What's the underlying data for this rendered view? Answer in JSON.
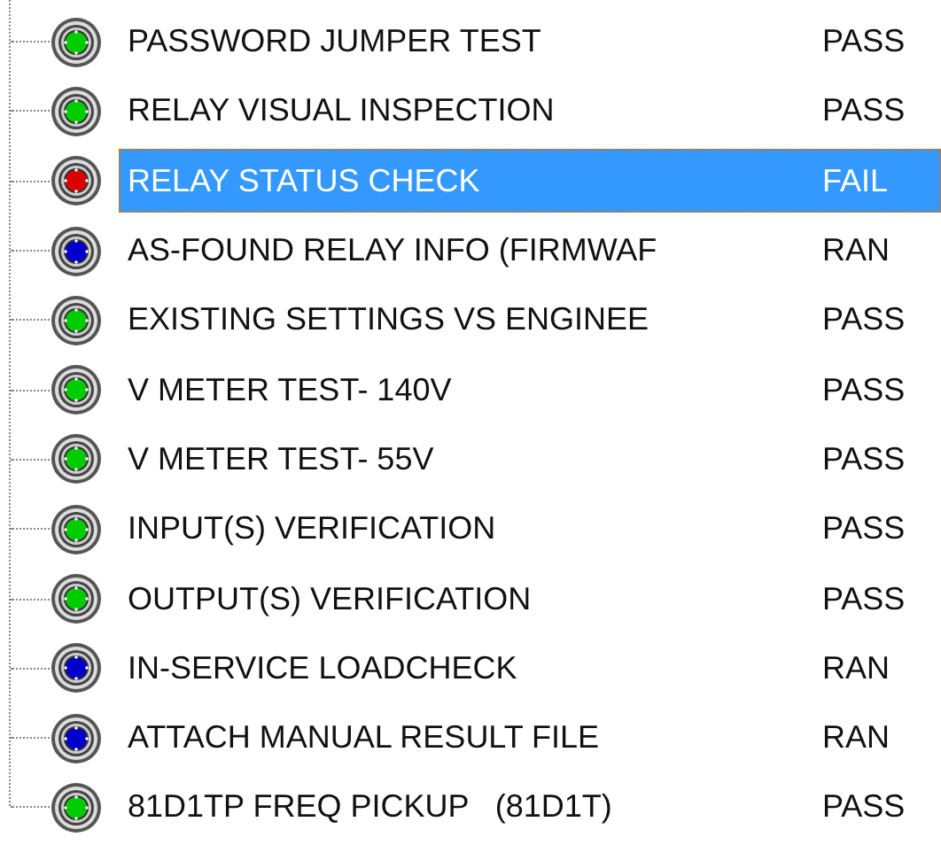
{
  "tests": [
    {
      "name": "PASSWORD JUMPER TEST",
      "result": "PASS",
      "color": "#00cc00",
      "selected": false
    },
    {
      "name": "RELAY VISUAL INSPECTION",
      "result": "PASS",
      "color": "#00cc00",
      "selected": false
    },
    {
      "name": "RELAY STATUS CHECK",
      "result": "FAIL",
      "color": "#dd0000",
      "selected": true
    },
    {
      "name": "AS-FOUND RELAY INFO (FIRMWAF",
      "result": "RAN",
      "color": "#0000cc",
      "selected": false
    },
    {
      "name": "EXISTING SETTINGS VS ENGINEE",
      "result": "PASS",
      "color": "#00cc00",
      "selected": false
    },
    {
      "name": "V METER TEST- 140V",
      "result": "PASS",
      "color": "#00cc00",
      "selected": false
    },
    {
      "name": "V METER TEST- 55V",
      "result": "PASS",
      "color": "#00cc00",
      "selected": false
    },
    {
      "name": "INPUT(S) VERIFICATION",
      "result": "PASS",
      "color": "#00cc00",
      "selected": false
    },
    {
      "name": "OUTPUT(S) VERIFICATION",
      "result": "PASS",
      "color": "#00cc00",
      "selected": false
    },
    {
      "name": "IN-SERVICE LOADCHECK",
      "result": "RAN",
      "color": "#0000cc",
      "selected": false
    },
    {
      "name": "ATTACH MANUAL RESULT FILE",
      "result": "RAN",
      "color": "#0000cc",
      "selected": false
    },
    {
      "name": "81D1TP FREQ PICKUP   (81D1T)",
      "result": "PASS",
      "color": "#00cc00",
      "selected": false
    }
  ]
}
